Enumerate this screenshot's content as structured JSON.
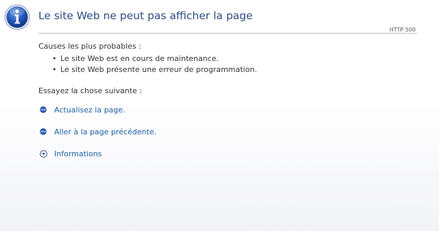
{
  "header": {
    "title": "Le site Web ne peut pas afficher la page",
    "status_code": "HTTP 500",
    "icon": "info-icon"
  },
  "causes": {
    "heading": "Causes les plus probables :",
    "items": [
      "Le site Web est en cours de maintenance.",
      "Le site Web présente une erreur de programmation."
    ]
  },
  "actions": {
    "heading": "Essayez la chose suivante :",
    "refresh_label": "Actualisez la page.",
    "back_label": "Aller à la page précédente.",
    "info_label": "Informations"
  },
  "colors": {
    "title": "#2b4d82",
    "link": "#1d5fa8",
    "icon_blue": "#1f4fa5",
    "rule": "#b9bcc2"
  }
}
